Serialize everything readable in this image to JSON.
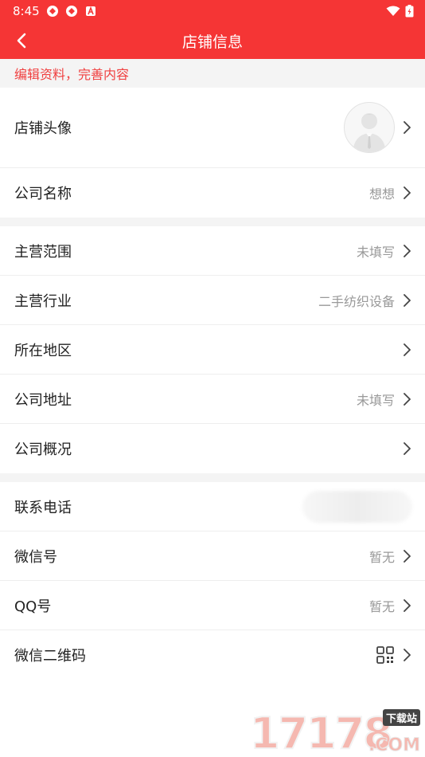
{
  "status_bar": {
    "time": "8:45",
    "accent": "#f53535"
  },
  "nav": {
    "title": "店铺信息"
  },
  "notice": {
    "text": "编辑资料，完善内容"
  },
  "sections": {
    "profile": [
      {
        "label": "店铺头像",
        "value": ""
      },
      {
        "label": "公司名称",
        "value": "想想"
      }
    ],
    "business": [
      {
        "label": "主营范围",
        "value": "未填写"
      },
      {
        "label": "主营行业",
        "value": "二手纺织设备"
      },
      {
        "label": "所在地区",
        "value": ""
      },
      {
        "label": "公司地址",
        "value": "未填写"
      },
      {
        "label": "公司概况",
        "value": ""
      }
    ],
    "contact": [
      {
        "label": "联系电话",
        "value": ""
      },
      {
        "label": "微信号",
        "value": "暂无"
      },
      {
        "label": "QQ号",
        "value": "暂无"
      },
      {
        "label": "微信二维码",
        "value": ""
      }
    ]
  },
  "watermark": {
    "number": "17178",
    "tag": "下载站",
    "suffix": ".COM"
  }
}
